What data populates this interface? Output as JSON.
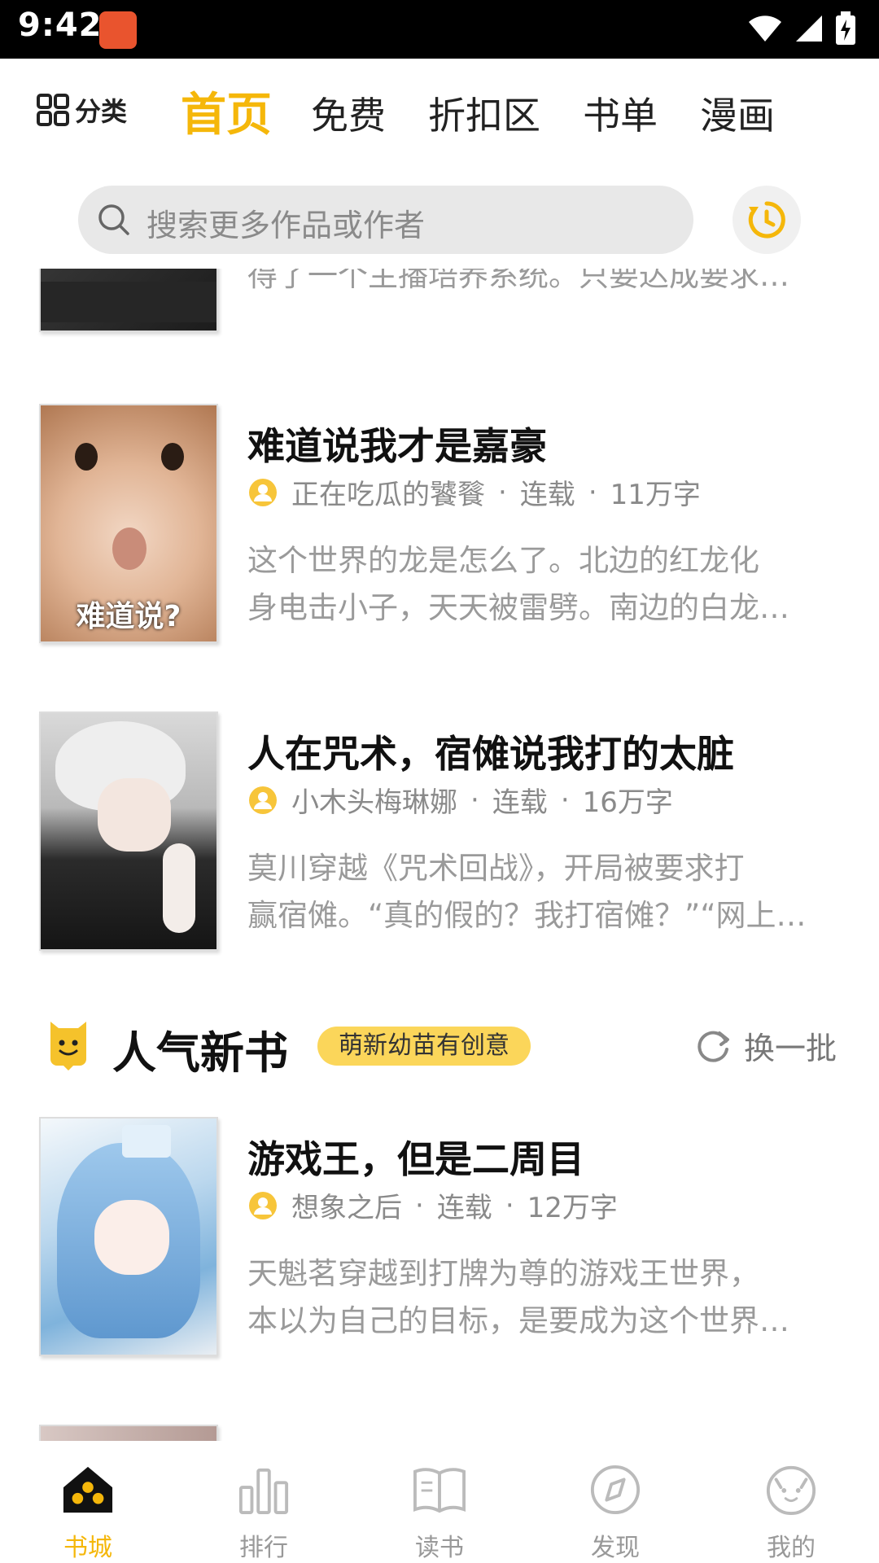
{
  "status_bar": {
    "time": "9:42"
  },
  "top_nav": {
    "category_label": "分类",
    "tabs": [
      {
        "label": "首页",
        "active": true
      },
      {
        "label": "免费",
        "active": false
      },
      {
        "label": "折扣区",
        "active": false
      },
      {
        "label": "书单",
        "active": false
      },
      {
        "label": "漫画",
        "active": false
      }
    ]
  },
  "search": {
    "placeholder": "搜索更多作品或作者"
  },
  "partial_book": {
    "desc_line": "得了一个主播培养系统。只要达成要求…"
  },
  "books": [
    {
      "title": "难道说我才是嘉豪",
      "author": "正在吃瓜的饕餮",
      "status": "连载",
      "words": "11万字",
      "desc_lines": [
        "这个世界的龙是怎么了。北边的红龙化",
        "身电击小子，天天被雷劈。南边的白龙…"
      ],
      "cover_text": "难道说?"
    },
    {
      "title": "人在咒术，宿傩说我打的太脏",
      "author": "小木头梅琳娜",
      "status": "连载",
      "words": "16万字",
      "desc_lines": [
        "莫川穿越《咒术回战》，开局被要求打",
        "赢宿傩。“真的假的？我打宿傩？”“网上…"
      ]
    }
  ],
  "section": {
    "title": "人气新书",
    "badge": "萌新幼苗有创意",
    "refresh_label": "换一批"
  },
  "section_books": [
    {
      "title": "游戏王，但是二周目",
      "author": "想象之后",
      "status": "连载",
      "words": "12万字",
      "desc_lines": [
        "天魁茗穿越到打牌为尊的游戏王世界，",
        "本以为自己的目标，是要成为这个世界…"
      ]
    }
  ],
  "bottom_tabs": [
    {
      "label": "书城",
      "icon": "home-icon",
      "active": true
    },
    {
      "label": "排行",
      "icon": "ranking-icon",
      "active": false
    },
    {
      "label": "读书",
      "icon": "book-icon",
      "active": false
    },
    {
      "label": "发现",
      "icon": "compass-icon",
      "active": false
    },
    {
      "label": "我的",
      "icon": "cat-face-icon",
      "active": false
    }
  ],
  "colors": {
    "accent": "#f5b70a",
    "badge": "#fbd65a",
    "muted": "#9a9a9a"
  }
}
